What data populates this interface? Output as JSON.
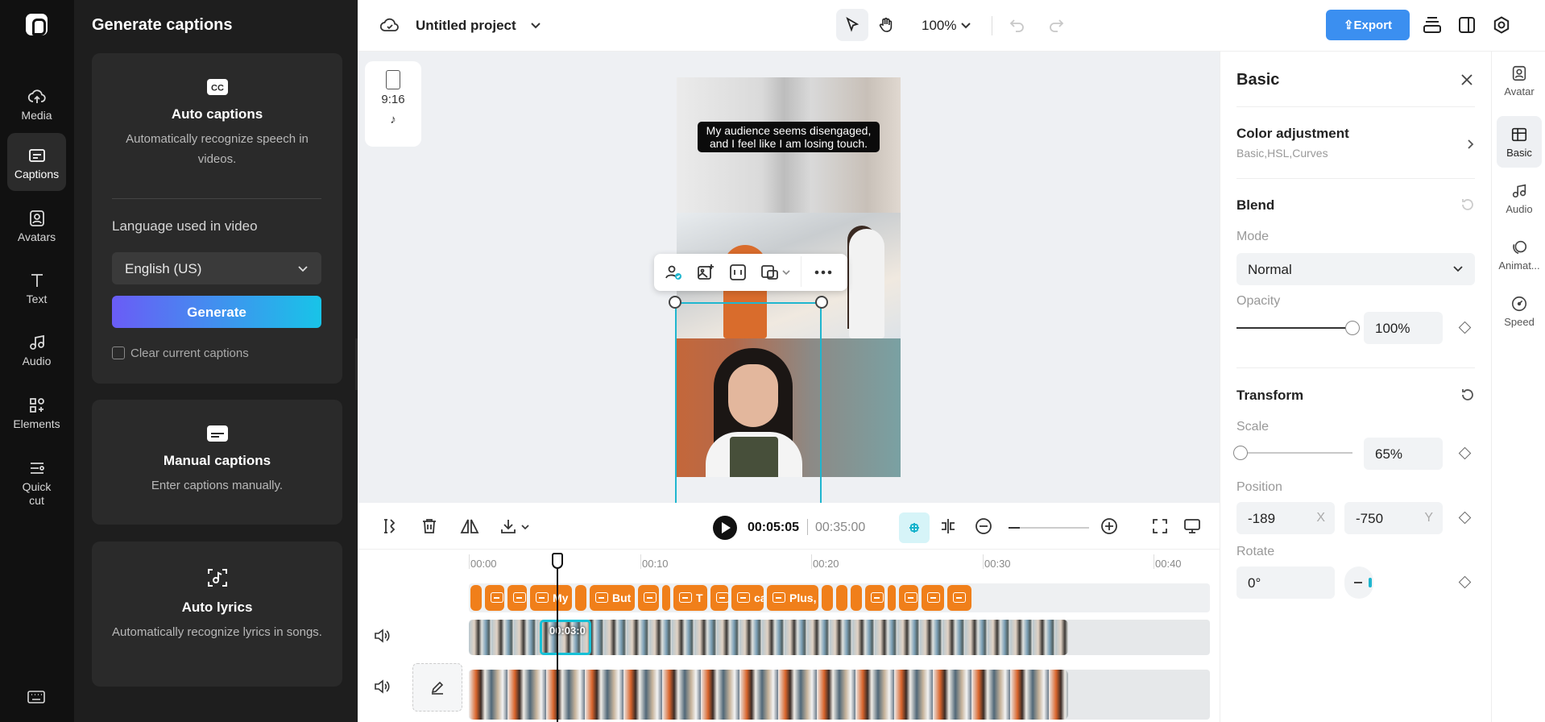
{
  "nav": {
    "items": [
      {
        "label": "Media",
        "icon": "cloud-upload-icon"
      },
      {
        "label": "Captions",
        "icon": "captions-icon"
      },
      {
        "label": "Avatars",
        "icon": "avatar-icon"
      },
      {
        "label": "Text",
        "icon": "text-icon"
      },
      {
        "label": "Audio",
        "icon": "music-icon"
      },
      {
        "label": "Elements",
        "icon": "elements-icon"
      },
      {
        "label": "Quick\ncut",
        "icon": "quick-cut-icon"
      }
    ],
    "active": "Captions"
  },
  "panel": {
    "title": "Generate captions",
    "auto": {
      "title": "Auto captions",
      "desc": "Automatically recognize speech in videos."
    },
    "language_label": "Language used in video",
    "language_value": "English (US)",
    "generate_label": "Generate",
    "clear_label": "Clear current captions",
    "manual": {
      "title": "Manual captions",
      "desc": "Enter captions manually."
    },
    "lyrics": {
      "title": "Auto lyrics",
      "desc": "Automatically recognize lyrics in songs."
    }
  },
  "topbar": {
    "project_title": "Untitled project",
    "zoom": "100%",
    "export_label": "Export"
  },
  "canvas": {
    "ratio_label": "9:16",
    "caption_line1": "My audience seems disengaged,",
    "caption_line2": "and I feel like I am losing touch."
  },
  "props": {
    "title": "Basic",
    "color_adjustment": {
      "title": "Color adjustment",
      "sub": "Basic,HSL,Curves"
    },
    "blend": {
      "title": "Blend",
      "mode_label": "Mode",
      "mode_value": "Normal",
      "opacity_label": "Opacity",
      "opacity_value": "100%",
      "opacity_level": 1.0
    },
    "transform": {
      "title": "Transform",
      "scale_label": "Scale",
      "scale_value": "65%",
      "scale_level": 0.0,
      "position_label": "Position",
      "pos_x": "-189",
      "pos_x_suffix": "X",
      "pos_y": "-750",
      "pos_y_suffix": "Y",
      "rotate_label": "Rotate",
      "rotate_value": "0°"
    }
  },
  "sidetabs": [
    {
      "label": "Avatar",
      "icon": "avatar-icon"
    },
    {
      "label": "Basic",
      "icon": "basic-icon"
    },
    {
      "label": "Audio",
      "icon": "music-icon"
    },
    {
      "label": "Animat...",
      "icon": "animation-icon"
    },
    {
      "label": "Speed",
      "icon": "speed-icon"
    }
  ],
  "timeline": {
    "current_time": "00:05:05",
    "total_time": "00:35:00",
    "ruler": [
      "00:00",
      "00:10",
      "00:20",
      "00:30",
      "00:40"
    ],
    "selected_clip_time": "00:03:0",
    "caption_clips": [
      "",
      "",
      "",
      "My",
      "",
      "But",
      "",
      "",
      "T",
      "",
      "ca",
      "Plus, ’",
      "",
      "",
      "",
      "",
      "",
      "",
      "",
      ""
    ]
  }
}
